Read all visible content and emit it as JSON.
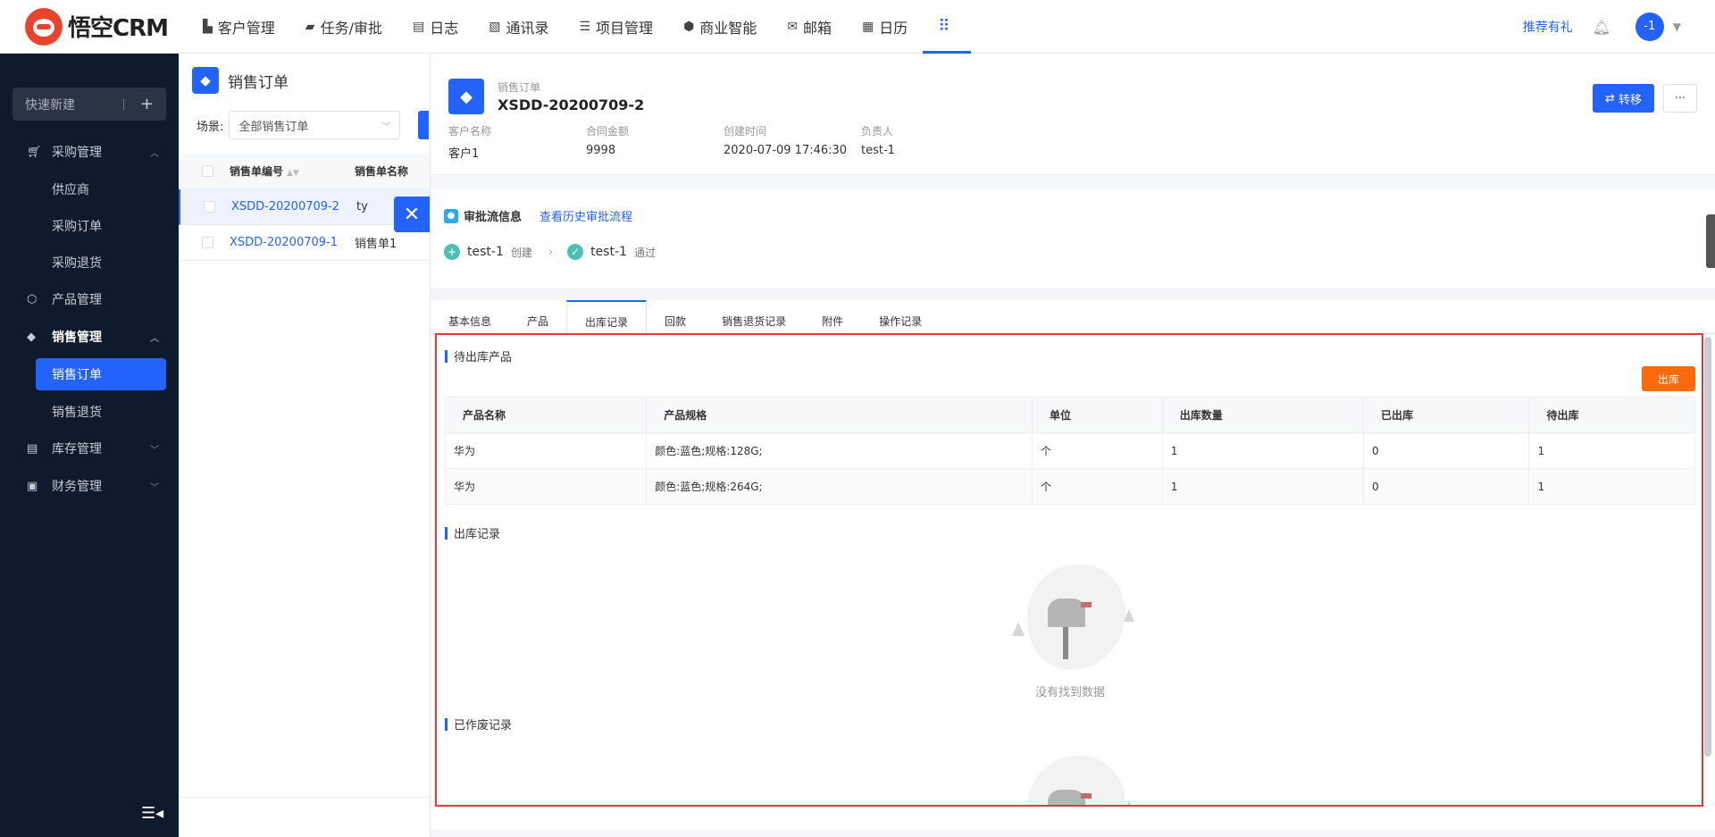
{
  "app": {
    "logo_text": "悟空CRM"
  },
  "topnav": {
    "items": [
      {
        "label": "客户管理",
        "icon": "building-icon"
      },
      {
        "label": "任务/审批",
        "icon": "briefcase-icon"
      },
      {
        "label": "日志",
        "icon": "note-icon"
      },
      {
        "label": "通讯录",
        "icon": "phonebook-icon"
      },
      {
        "label": "项目管理",
        "icon": "list-icon"
      },
      {
        "label": "商业智能",
        "icon": "chart-icon"
      },
      {
        "label": "邮箱",
        "icon": "mail-icon"
      },
      {
        "label": "日历",
        "icon": "calendar-icon"
      }
    ],
    "recommend": "推荐有礼",
    "avatar": "-1"
  },
  "sidebar": {
    "quick_new": "快速新建",
    "purchase": "采购管理",
    "purchase_items": [
      "供应商",
      "采购订单",
      "采购退货"
    ],
    "product": "产品管理",
    "sales": "销售管理",
    "sales_items": [
      "销售订单",
      "销售退货"
    ],
    "inventory": "库存管理",
    "finance": "财务管理"
  },
  "list": {
    "title": "销售订单",
    "scene_label": "场景:",
    "scene_value": "全部销售订单",
    "col1": "销售单编号",
    "col2": "销售单名称",
    "rows": [
      {
        "code": "XSDD-20200709-2",
        "name": "ty"
      },
      {
        "code": "XSDD-20200709-1",
        "name": "销售单1"
      }
    ]
  },
  "detail": {
    "type": "销售订单",
    "code": "XSDD-20200709-2",
    "transfer": "转移",
    "more": "···",
    "meta": [
      {
        "k": "客户名称",
        "v": "客户1"
      },
      {
        "k": "合同金额",
        "v": "9998"
      },
      {
        "k": "创建时间",
        "v": "2020-07-09 17:46:30"
      },
      {
        "k": "负责人",
        "v": "test-1"
      }
    ],
    "flow": {
      "title": "审批流信息",
      "history_link": "查看历史审批流程",
      "steps": [
        {
          "name": "test-1",
          "action": "创建"
        },
        {
          "name": "test-1",
          "action": "通过"
        }
      ]
    },
    "tabs": [
      "基本信息",
      "产品",
      "出库记录",
      "回款",
      "销售退货记录",
      "附件",
      "操作记录"
    ],
    "pending": {
      "title": "待出库产品",
      "button": "出库",
      "columns": [
        "产品名称",
        "产品规格",
        "单位",
        "出库数量",
        "已出库",
        "待出库"
      ],
      "rows": [
        [
          "华为",
          "颜色:蓝色;规格:128G;",
          "个",
          "1",
          "0",
          "1"
        ],
        [
          "华为",
          "颜色:蓝色;规格:264G;",
          "个",
          "1",
          "0",
          "1"
        ]
      ]
    },
    "outbound_title": "出库记录",
    "empty_text": "没有找到数据",
    "voided_title": "已作废记录"
  }
}
